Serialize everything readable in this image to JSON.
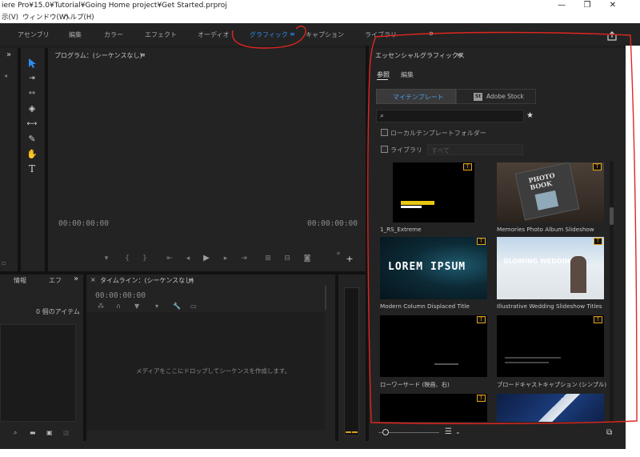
{
  "titlebar": {
    "title": "iere Pro¥15.0¥Tutorial¥Going Home project¥Get Started.prproj",
    "minimize": "—",
    "restore": "❐",
    "close": "✕"
  },
  "menubar": {
    "items": [
      "示(V)",
      "ウィンドウ(W)",
      "ヘルプ(H)"
    ]
  },
  "workspaces": {
    "items": [
      "アセンブリ",
      "編集",
      "カラー",
      "エフェクト",
      "オーディオ",
      "グラフィック",
      "キャプション",
      "ライブラリ"
    ],
    "active": "グラフィック",
    "menu_glyph": "≡",
    "more": "»",
    "share_icon": "export-icon"
  },
  "program_monitor": {
    "title": "プログラム：(シーケンスなし)",
    "menu": "≡",
    "timecode_left": "00:00:00:00",
    "timecode_right": "00:00:00:00"
  },
  "project_panel": {
    "tab_info": "情報",
    "tab_effects": "エフ",
    "more": "»",
    "item_count": "0 個のアイテム"
  },
  "timeline": {
    "close": "×",
    "title": "タイムライン：(シーケンスなし)",
    "menu": "≡",
    "timecode": "00:00:00:00",
    "drop_message": "メディアをここにドロップしてシーケンスを作成します。"
  },
  "essential_graphics": {
    "title": "エッセンシャルグラフィックス",
    "menu": "≡",
    "tabs": [
      "参照",
      "編集"
    ],
    "active_tab": "参照",
    "source_buttons": {
      "my_templates": "マイテンプレート",
      "adobe_stock": "Adobe Stock",
      "stock_badge": "St"
    },
    "search": {
      "placeholder": "",
      "star": "★"
    },
    "local_templates_label": "ローカルテンプレートフォルダー",
    "libraries_label": "ライブラリ",
    "libraries_select": "すべて",
    "templates": [
      {
        "caption": "1_RS_Extreme"
      },
      {
        "caption": "Memories Photo Album Slideshow",
        "thumb_text": "PHOTO BOOK"
      },
      {
        "caption": "Modern Column Displaced Title",
        "thumb_text": "LOREM IPSUM"
      },
      {
        "caption": "Illustrative Wedding Slideshow Titles",
        "thumb_text": "GLOWING WEDDING"
      },
      {
        "caption": "ローワーサード (映画、右)"
      },
      {
        "caption": "ブロードキャストキャプション (シンプル)"
      },
      {
        "caption": ""
      },
      {
        "caption": ""
      }
    ]
  },
  "colors": {
    "accent": "#2d8ceb",
    "badge": "#e8a317",
    "annotation": "#e0261f",
    "audio_meter": "#d4a017"
  }
}
